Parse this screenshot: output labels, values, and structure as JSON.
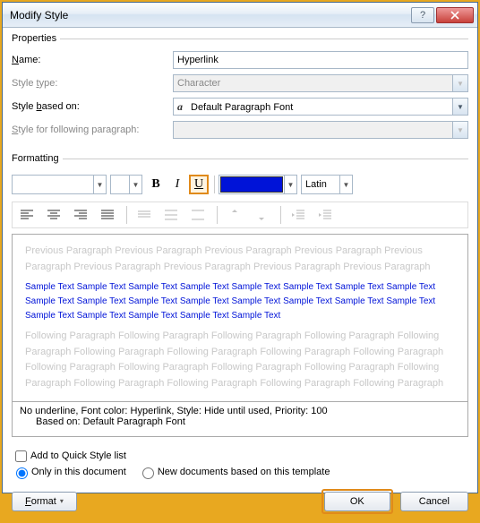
{
  "title": "Modify Style",
  "groups": {
    "properties": "Properties",
    "formatting": "Formatting"
  },
  "props": {
    "name_label": "Name:",
    "name_value": "Hyperlink",
    "type_label": "Style type:",
    "type_value": "Character",
    "based_label": "Style based on:",
    "based_value": "Default Paragraph Font",
    "following_label": "Style for following paragraph:",
    "following_value": ""
  },
  "toolbar": {
    "font": "",
    "size": "",
    "bold": "B",
    "italic": "I",
    "underline": "U",
    "script": "Latin"
  },
  "preview": {
    "prev": "Previous Paragraph Previous Paragraph Previous Paragraph Previous Paragraph Previous Paragraph Previous Paragraph Previous Paragraph Previous Paragraph Previous Paragraph",
    "sample": "Sample Text Sample Text Sample Text Sample Text Sample Text Sample Text Sample Text Sample Text Sample Text Sample Text Sample Text Sample Text Sample Text Sample Text Sample Text Sample Text Sample Text Sample Text Sample Text Sample Text Sample Text",
    "next": "Following Paragraph Following Paragraph Following Paragraph Following Paragraph Following Paragraph Following Paragraph Following Paragraph Following Paragraph Following Paragraph Following Paragraph Following Paragraph Following Paragraph Following Paragraph Following Paragraph Following Paragraph Following Paragraph Following Paragraph Following Paragraph"
  },
  "description": {
    "line1": "No underline, Font color: Hyperlink, Style: Hide until used, Priority: 100",
    "line2": "Based on: Default Paragraph Font"
  },
  "options": {
    "quick": "Add to Quick Style list",
    "only": "Only in this document",
    "template": "New documents based on this template"
  },
  "buttons": {
    "format": "Format",
    "ok": "OK",
    "cancel": "Cancel"
  },
  "colors": {
    "accent": "#0013d8"
  }
}
